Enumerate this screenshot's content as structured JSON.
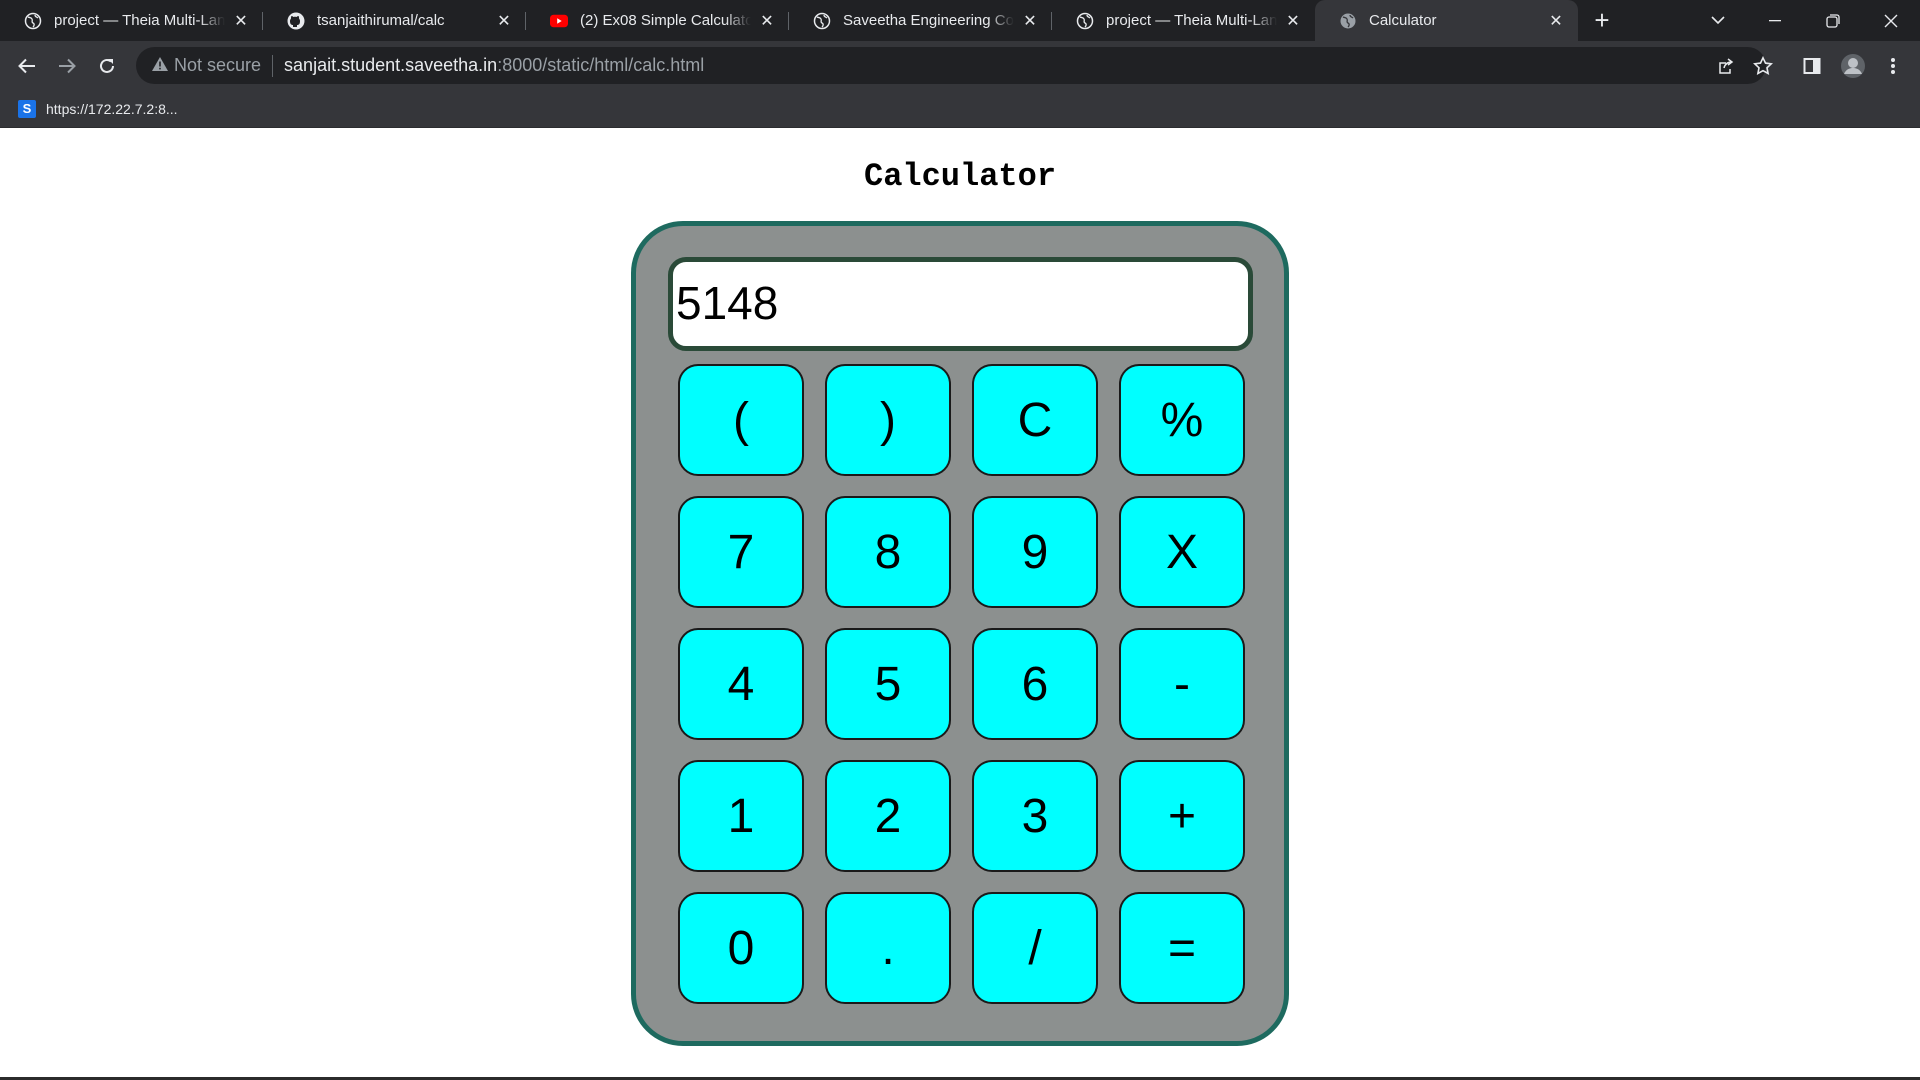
{
  "tabs": [
    {
      "title": "project — Theia Multi-Language",
      "icon": "globe-icon",
      "active": false
    },
    {
      "title": "tsanjaithirumal/calc",
      "icon": "github-icon",
      "active": false
    },
    {
      "title": "(2) Ex08 Simple Calculator - YouTube",
      "icon": "youtube-icon",
      "active": false
    },
    {
      "title": "Saveetha Engineering College",
      "icon": "globe-icon",
      "active": false
    },
    {
      "title": "project — Theia Multi-Language",
      "icon": "globe-icon",
      "active": false
    },
    {
      "title": "Calculator",
      "icon": "globe-icon",
      "active": true
    }
  ],
  "address": {
    "security_label": "Not secure",
    "host": "sanjait.student.saveetha.in",
    "path": ":8000/static/html/calc.html"
  },
  "bookmarks": [
    {
      "label": "https://172.22.7.2:8...",
      "icon": "S"
    }
  ],
  "page": {
    "title": "Calculator"
  },
  "calculator": {
    "display": "5148",
    "keys": [
      "(",
      ")",
      "C",
      "%",
      "7",
      "8",
      "9",
      "X",
      "4",
      "5",
      "6",
      "-",
      "1",
      "2",
      "3",
      "+",
      "0",
      ".",
      "/",
      "="
    ]
  },
  "colors": {
    "key_bg": "#00ffff",
    "body_bg": "#8c908f",
    "body_border": "#1e6a5f",
    "display_border": "#2a4a38"
  }
}
